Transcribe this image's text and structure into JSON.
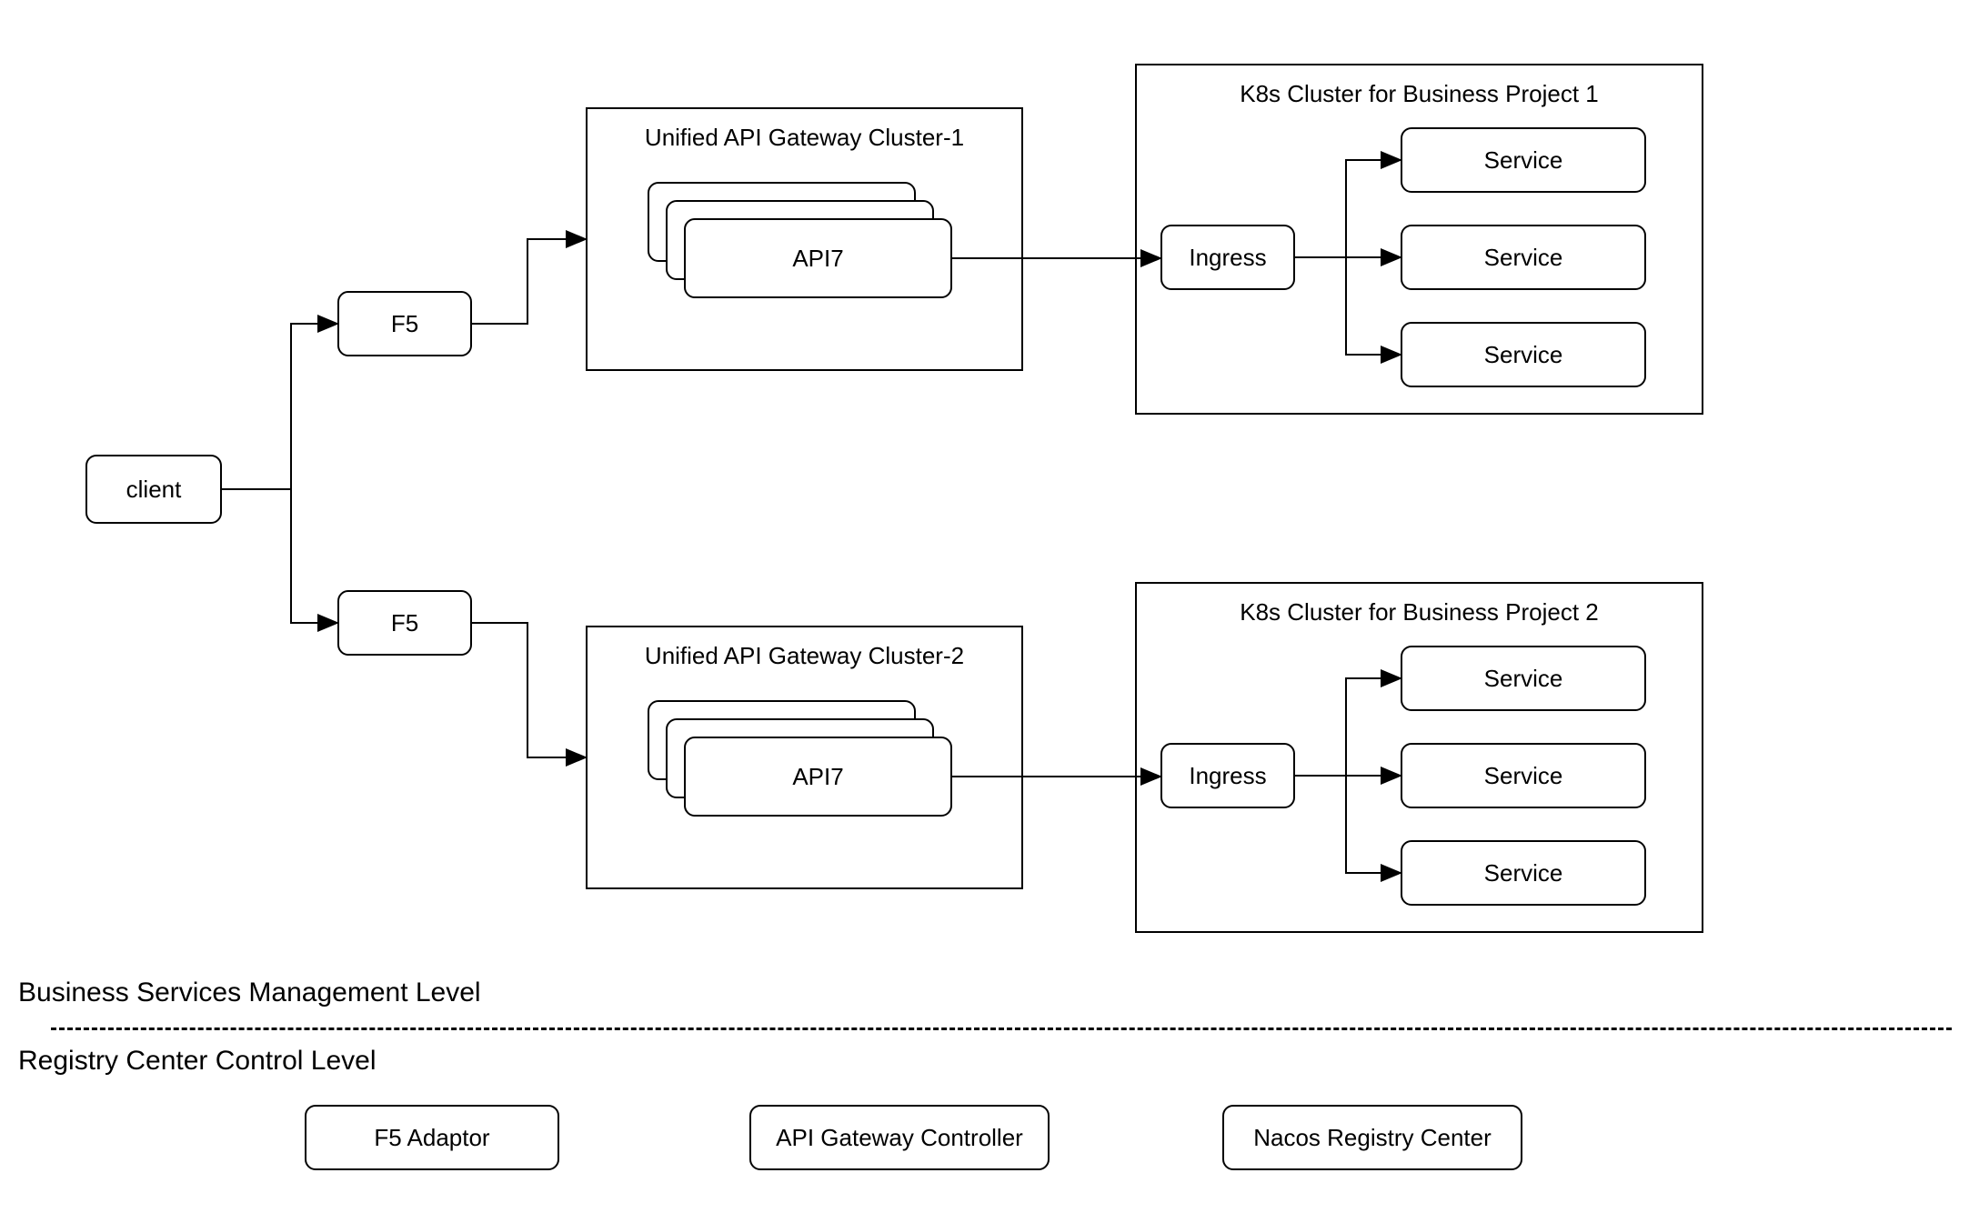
{
  "nodes": {
    "client": "client",
    "f5": "F5",
    "api7": "API7",
    "ingress": "Ingress",
    "service": "Service"
  },
  "containers": {
    "gateway1": "Unified API Gateway Cluster-1",
    "gateway2": "Unified API Gateway Cluster-2",
    "k8s1": "K8s Cluster for Business Project 1",
    "k8s2": "K8s Cluster for Business Project 2"
  },
  "sections": {
    "business": "Business Services Management Level",
    "registry": "Registry Center Control Level"
  },
  "registry_nodes": {
    "f5_adaptor": "F5 Adaptor",
    "api_controller": "API Gateway Controller",
    "nacos": "Nacos Registry Center"
  }
}
